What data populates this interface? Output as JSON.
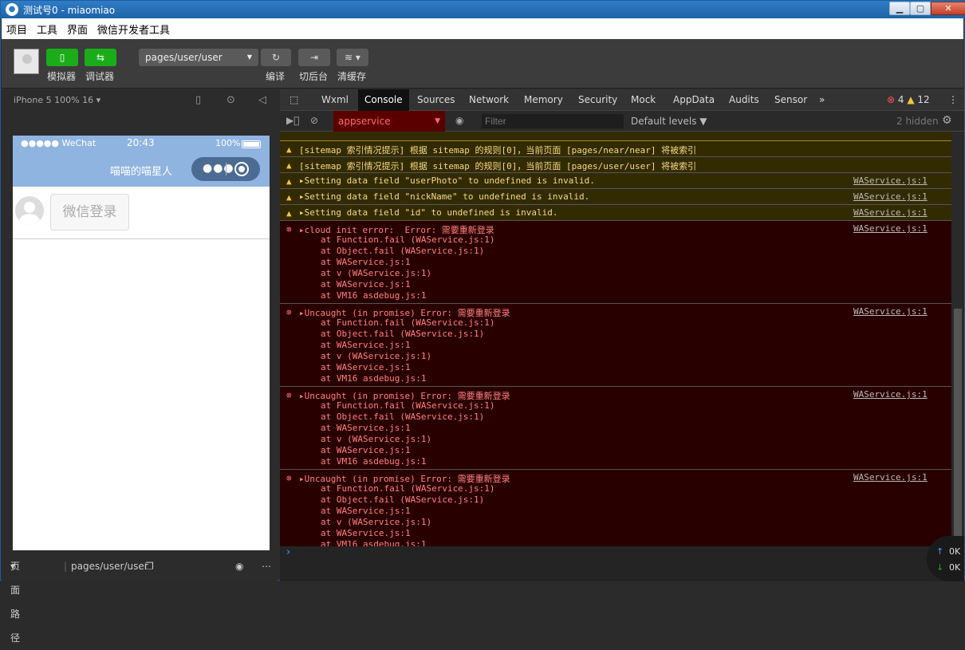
{
  "window": {
    "title": "测试号0 - miaomiao"
  },
  "menu": [
    "项目",
    "工具",
    "界面",
    "微信开发者工具"
  ],
  "toolbar": {
    "simulator_label": "模拟器",
    "debugger_label": "调试器",
    "page_path": "pages/user/user",
    "compile_label": "编译",
    "switch_label": "切后台",
    "clear_label": "清缓存"
  },
  "device": {
    "label": "iPhone 5 100% 16"
  },
  "phone": {
    "carrier": "●●●●● WeChat",
    "time": "20:43",
    "battery": "100%",
    "nav_title": "喵喵的喵星人",
    "login_button": "微信登录"
  },
  "bottom": {
    "path_label": "页面路径",
    "path": "pages/user/user"
  },
  "devtools": {
    "tabs": [
      "Wxml",
      "Console",
      "Sources",
      "Network",
      "Memory",
      "Security",
      "Mock",
      "AppData",
      "Audits",
      "Sensor"
    ],
    "error_count": "4",
    "warning_count": "12",
    "context": "appservice",
    "filter_placeholder": "Filter",
    "levels": "Default levels",
    "hidden": "2 hidden"
  },
  "logs": [
    {
      "level": "warn",
      "text": "[sitemap 索引情况提示] 根据 sitemap 的规则[0]，当前页面 [pages/near/near] 将被索引",
      "src": ""
    },
    {
      "level": "warn",
      "text": "[sitemap 索引情况提示] 根据 sitemap 的规则[0]，当前页面 [pages/user/user] 将被索引",
      "src": ""
    },
    {
      "level": "warn",
      "text": "▸Setting data field \"userPhoto\" to undefined is invalid.",
      "src": "WAService.js:1"
    },
    {
      "level": "warn",
      "text": "▸Setting data field \"nickName\" to undefined is invalid.",
      "src": "WAService.js:1"
    },
    {
      "level": "warn",
      "text": "▸Setting data field \"id\" to undefined is invalid.",
      "src": "WAService.js:1"
    },
    {
      "level": "err",
      "text": "▸cloud init error:  Error: 需要重新登录",
      "src": "WAService.js:1"
    },
    {
      "level": "err",
      "text": "▸Uncaught (in promise) Error: 需要重新登录",
      "src": "WAService.js:1"
    },
    {
      "level": "err",
      "text": "▸Uncaught (in promise) Error: 需要重新登录",
      "src": "WAService.js:1"
    },
    {
      "level": "err",
      "text": "▸Uncaught (in promise) Error: 需要重新登录",
      "src": "WAService.js:1"
    }
  ],
  "stack": [
    "at Function.fail (WAService.js:1)",
    "at Object.fail (WAService.js:1)",
    "at WAService.js:1",
    "at v (WAService.js:1)",
    "at WAService.js:1",
    "at VM16 asdebug.js:1"
  ],
  "network": {
    "up": "0K",
    "down": "0K"
  }
}
